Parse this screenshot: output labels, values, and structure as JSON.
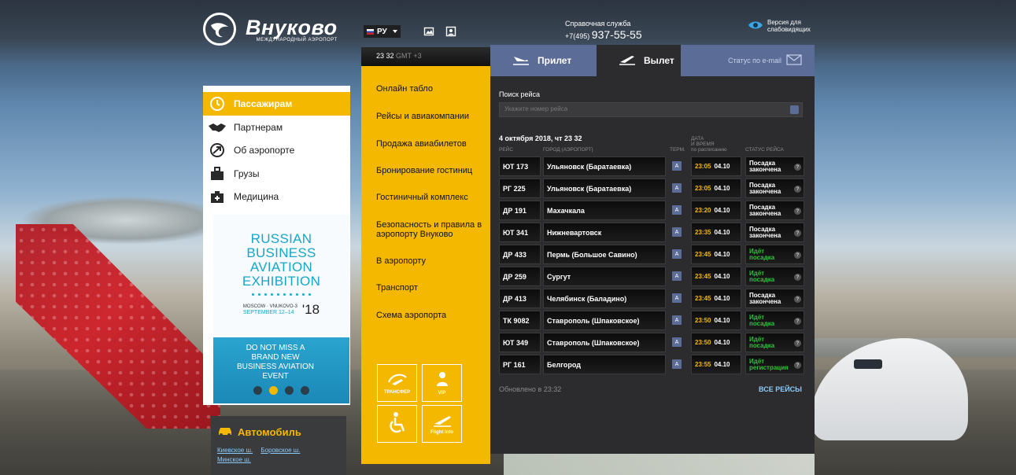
{
  "header": {
    "logo_name": "Внуково",
    "logo_sub": "МЕЖДУНАРОДНЫЙ АЭРОПОРТ",
    "lang": "РУ",
    "help_label": "Справочная служба",
    "help_code": "+7(495)",
    "help_number": "937-55-55",
    "accessible_line1": "Версия для",
    "accessible_line2": "слабовидящих"
  },
  "sidebar": {
    "items": [
      {
        "label": "Пассажирам",
        "icon": "clock-icon"
      },
      {
        "label": "Партнерам",
        "icon": "handshake-icon"
      },
      {
        "label": "Об аэропорте",
        "icon": "plane-circle-icon"
      },
      {
        "label": "Грузы",
        "icon": "cargo-icon"
      },
      {
        "label": "Медицина",
        "icon": "medkit-icon"
      }
    ]
  },
  "banner": {
    "line1": "RUSSIAN",
    "line2": "BUSINESS",
    "line3": "AVIATION",
    "line4": "EXHIBITION",
    "place": "MOSCOW · VNUKOVO-3",
    "dates": "SEPTEMBER 12–14",
    "year": "'18",
    "bottom_text": "DO NOT MISS A BRAND NEW BUSINESS AVIATION EVENT"
  },
  "car_panel": {
    "title": "Автомобиль",
    "links": [
      "Киевское ш.",
      "Боровское ш.",
      "Минское ш."
    ]
  },
  "clock": {
    "time": "23 32",
    "gmt": "GMT +3"
  },
  "menu": {
    "items": [
      "Онлайн табло",
      "Рейсы и авиакомпании",
      "Продажа авиабилетов",
      "Бронирование гостиниц",
      "Гостиничный комплекс",
      "Безопасность и правила в аэропорту Внуково",
      "В аэропорту",
      "Транспорт",
      "Схема аэропорта"
    ],
    "tiles": [
      {
        "label": "ТРАНСФЕР",
        "icon": "transfer-icon"
      },
      {
        "label": "VIP",
        "icon": "vip-person-icon"
      },
      {
        "label": "",
        "icon": "wheelchair-icon"
      },
      {
        "label": "Flight info",
        "icon": "flight-info-icon"
      }
    ]
  },
  "board": {
    "tab_arrivals": "Прилет",
    "tab_departures": "Вылет",
    "email_status": "Статус по e-mail",
    "search_label": "Поиск рейса",
    "search_placeholder": "Укажите номер рейса",
    "date_line": "4 октября 2018, чт 23 32",
    "columns": {
      "flight": "РЕЙС",
      "city": "ГОРОД (АЭРОПОРТ)",
      "term": "ТЕРМ.",
      "datetime1": "ДАТА",
      "datetime2": "И ВРЕМЯ",
      "datetime3": "по расписанию",
      "status": "СТАТУС РЕЙСА"
    },
    "rows": [
      {
        "flight": "ЮТ 173",
        "city": "Ульяновск (Баратаевка)",
        "term": "A",
        "time": "23:05",
        "date": "04.10",
        "status1": "Посадка",
        "status2": "закончена",
        "green": false
      },
      {
        "flight": "РГ 225",
        "city": "Ульяновск (Баратаевка)",
        "term": "A",
        "time": "23:05",
        "date": "04.10",
        "status1": "Посадка",
        "status2": "закончена",
        "green": false
      },
      {
        "flight": "ДР 191",
        "city": "Махачкала",
        "term": "A",
        "time": "23:20",
        "date": "04.10",
        "status1": "Посадка",
        "status2": "закончена",
        "green": false
      },
      {
        "flight": "ЮТ 341",
        "city": "Нижневартовск",
        "term": "A",
        "time": "23:35",
        "date": "04.10",
        "status1": "Посадка",
        "status2": "закончена",
        "green": false
      },
      {
        "flight": "ДР 433",
        "city": "Пермь (Большое Савино)",
        "term": "A",
        "time": "23:45",
        "date": "04.10",
        "status1": "Идёт",
        "status2": "посадка",
        "green": true
      },
      {
        "flight": "ДР 259",
        "city": "Сургут",
        "term": "A",
        "time": "23:45",
        "date": "04.10",
        "status1": "Идёт",
        "status2": "посадка",
        "green": true
      },
      {
        "flight": "ДР 413",
        "city": "Челябинск (Баладино)",
        "term": "A",
        "time": "23:45",
        "date": "04.10",
        "status1": "Посадка",
        "status2": "закончена",
        "green": false
      },
      {
        "flight": "ТК 9082",
        "city": "Ставрополь (Шпаковское)",
        "term": "A",
        "time": "23:50",
        "date": "04.10",
        "status1": "Идёт",
        "status2": "посадка",
        "green": true
      },
      {
        "flight": "ЮТ 349",
        "city": "Ставрополь (Шпаковское)",
        "term": "A",
        "time": "23:50",
        "date": "04.10",
        "status1": "Идёт",
        "status2": "посадка",
        "green": true
      },
      {
        "flight": "РГ 161",
        "city": "Белгород",
        "term": "A",
        "time": "23:55",
        "date": "04.10",
        "status1": "Идёт",
        "status2": "регистрация",
        "green": true
      }
    ],
    "updated": "Обновлено в 23:32",
    "all_flights": "ВСЕ РЕЙСЫ"
  },
  "colors": {
    "accent": "#f5b800",
    "tab": "#5b6c97",
    "board_bg": "#2c2c2e",
    "status_green": "#2ec13a"
  }
}
